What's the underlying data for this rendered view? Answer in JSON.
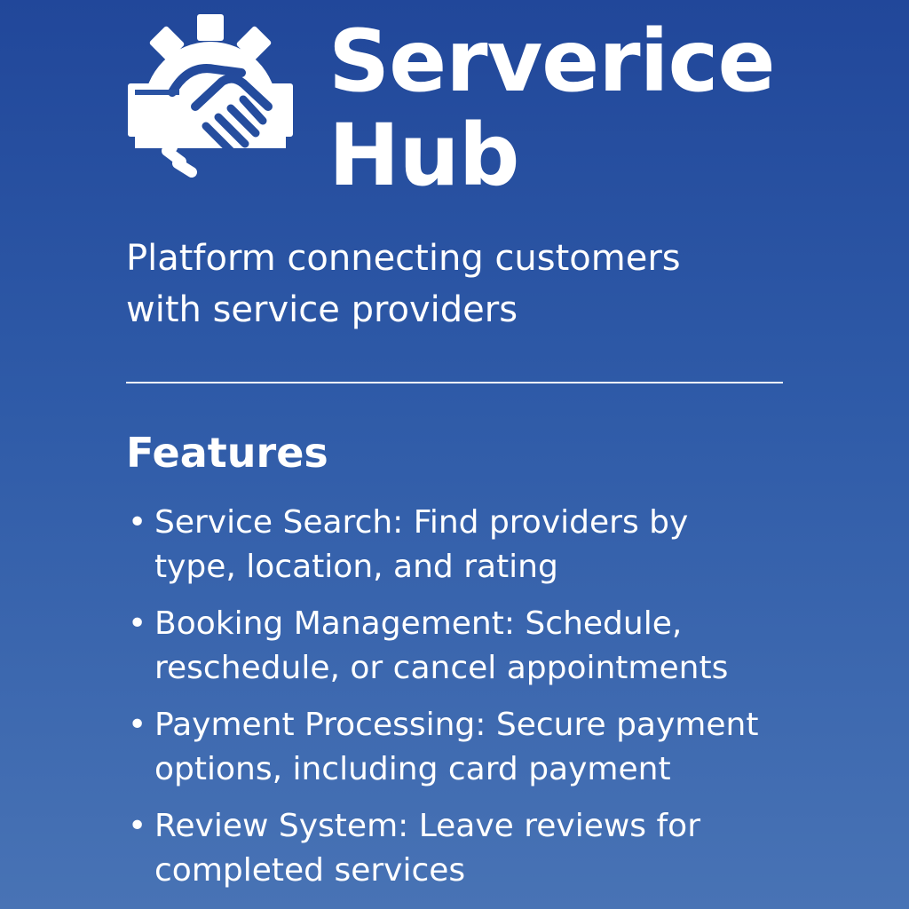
{
  "brand": {
    "title_line1": "Serverice",
    "title_line2": "Hub",
    "logo_icon": "gear-handshake-icon"
  },
  "subtitle": {
    "line1": "Platform connecting customers",
    "line2": "with service providers"
  },
  "features": {
    "heading": "Features",
    "items": [
      {
        "line1": "Service Search: Find providers by",
        "line2": "type, location, and rating"
      },
      {
        "line1": "Booking Management: Schedule,",
        "line2": "reschedule, or cancel appointments"
      },
      {
        "line1": "Payment Processing: Secure payment",
        "line2": "options, including card payment"
      },
      {
        "line1": "Review System: Leave reviews for",
        "line2": "completed services"
      }
    ]
  },
  "colors": {
    "background_top": "#21479a",
    "background_bottom": "#4873b5",
    "text": "#ffffff"
  }
}
